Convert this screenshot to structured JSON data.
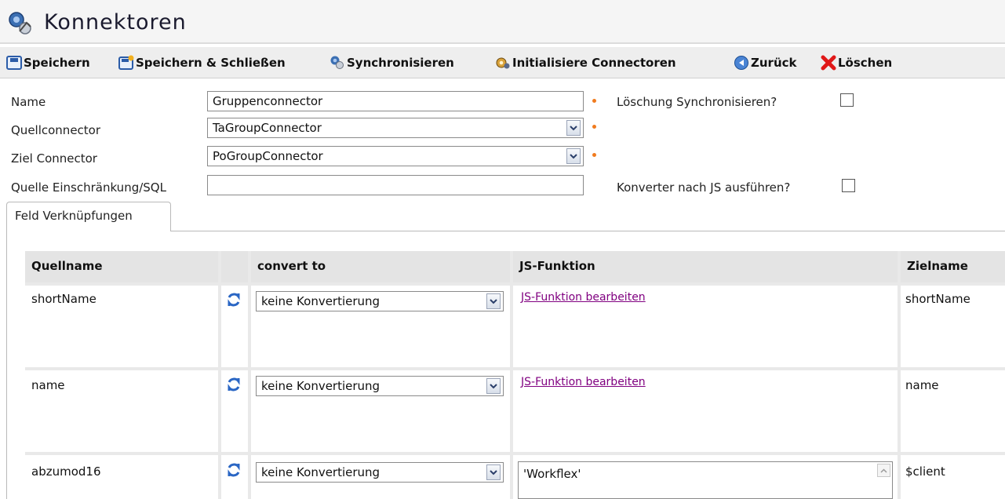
{
  "window": {
    "title": "Konnektoren",
    "title_icon": "connector-icon"
  },
  "toolbar": {
    "save": "Speichern",
    "save_close": "Speichern & Schließen",
    "sync": "Synchronisieren",
    "init": "Initialisiere Connectoren",
    "back": "Zurück",
    "delete": "Löschen"
  },
  "form": {
    "name_label": "Name",
    "name_value": "Gruppenconnector",
    "source_label": "Quellconnector",
    "source_value": "TaGroupConnector",
    "target_label": "Ziel Connector",
    "target_value": "PoGroupConnector",
    "restriction_label": "Quelle Einschränkung/SQL",
    "restriction_value": "",
    "sync_delete_label": "Löschung Synchronisieren?",
    "sync_delete_checked": false,
    "run_converter_label": "Konverter nach JS ausführen?",
    "run_converter_checked": false
  },
  "tabs": {
    "field_links": "Feld Verknüpfungen"
  },
  "table": {
    "headers": {
      "source": "Quellname",
      "convert": "convert to",
      "js": "JS-Funktion",
      "target": "Zielname"
    },
    "rows": [
      {
        "source": "shortName",
        "convert": "keine Konvertierung",
        "js_link": "JS-Funktion bearbeiten",
        "target": "shortName"
      },
      {
        "source": "name",
        "convert": "keine Konvertierung",
        "js_link": "JS-Funktion bearbeiten",
        "target": "name"
      },
      {
        "source": "abzumod16",
        "convert": "keine Konvertierung",
        "js_code": "'Workflex'",
        "target": "$client"
      }
    ]
  },
  "colors": {
    "required": "#f07b1e",
    "link": "#800080",
    "header_bg": "#e4e4e4"
  }
}
